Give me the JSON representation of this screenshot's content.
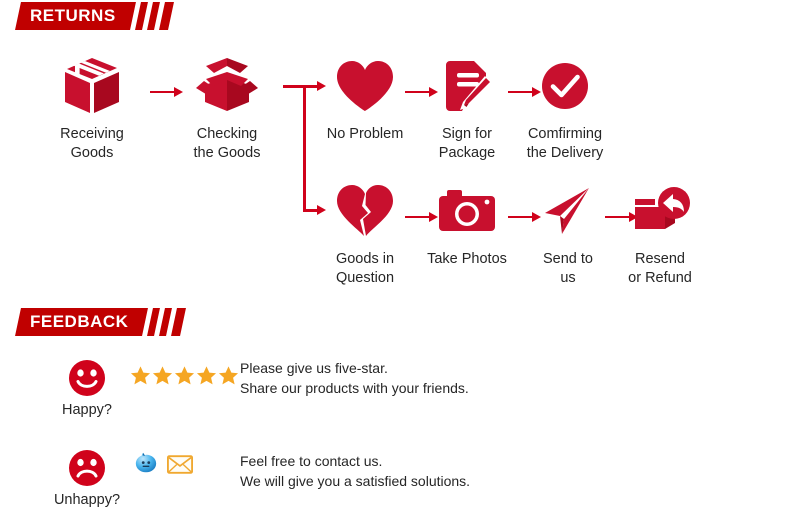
{
  "sections": {
    "returns": {
      "title": "RETURNS"
    },
    "feedback": {
      "title": "FEEDBACK"
    }
  },
  "colors": {
    "banner_red": "#C00000",
    "icon_red": "#C8102E",
    "arrow_red": "#D0021B",
    "star_gold": "#F5A623",
    "text_dark": "#262626",
    "chat_blue": "#3FA9F5",
    "envelope_orange": "#F5A623"
  },
  "returns_flow": {
    "row1": [
      {
        "id": "receiving-goods",
        "icon": "package-box-icon",
        "label": "Receiving\nGoods"
      },
      {
        "id": "checking-goods",
        "icon": "open-box-icon",
        "label": "Checking\nthe Goods"
      },
      {
        "id": "no-problem",
        "icon": "heart-icon",
        "label": "No Problem"
      },
      {
        "id": "sign-for-package",
        "icon": "document-pencil-icon",
        "label": "Sign for\nPackage"
      },
      {
        "id": "confirming-delivery",
        "icon": "check-circle-icon",
        "label": "Comfirming\nthe Delivery"
      }
    ],
    "row2": [
      {
        "id": "goods-in-question",
        "icon": "broken-heart-icon",
        "label": "Goods in\nQuestion"
      },
      {
        "id": "take-photos",
        "icon": "camera-icon",
        "label": "Take Photos"
      },
      {
        "id": "send-to-us",
        "icon": "paper-plane-icon",
        "label": "Send to\nus"
      },
      {
        "id": "resend-or-refund",
        "icon": "box-return-arrow-icon",
        "label": "Resend\nor Refund"
      }
    ]
  },
  "feedback": {
    "happy": {
      "face_icon": "smiley-happy-icon",
      "caption": "Happy?",
      "star_count": 5,
      "message": "Please give us five-star.\nShare our products with your friends."
    },
    "unhappy": {
      "face_icon": "smiley-sad-icon",
      "caption": "Unhappy?",
      "contact_icons": [
        "chat-bubble-icon",
        "envelope-icon"
      ],
      "message": "Feel free to contact us.\nWe will give you a satisfied solutions."
    }
  }
}
